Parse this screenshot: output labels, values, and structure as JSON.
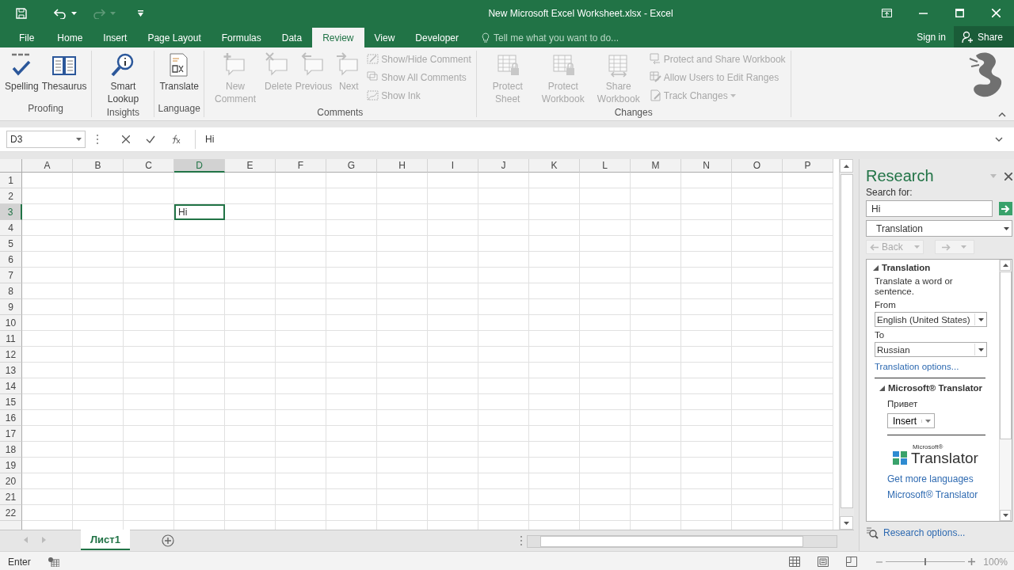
{
  "title_bar": {
    "title": "New Microsoft Excel Worksheet.xlsx - Excel"
  },
  "ribbon_tabs": [
    {
      "label": "File",
      "selected": false
    },
    {
      "label": "Home",
      "selected": false
    },
    {
      "label": "Insert",
      "selected": false
    },
    {
      "label": "Page Layout",
      "selected": false
    },
    {
      "label": "Formulas",
      "selected": false
    },
    {
      "label": "Data",
      "selected": false
    },
    {
      "label": "Review",
      "selected": true
    },
    {
      "label": "View",
      "selected": false
    },
    {
      "label": "Developer",
      "selected": false
    }
  ],
  "tell_me": {
    "placeholder": "Tell me what you want to do..."
  },
  "account": {
    "sign_in": "Sign in",
    "share": "Share"
  },
  "ribbon_groups": [
    {
      "label": "Proofing",
      "commands": [
        {
          "kind": "large",
          "label": "Spelling",
          "disabled": false
        },
        {
          "kind": "large",
          "label": "Thesaurus",
          "disabled": false
        }
      ]
    },
    {
      "label": "Insights",
      "commands": [
        {
          "kind": "large",
          "label": "Smart Lookup",
          "disabled": false
        }
      ]
    },
    {
      "label": "Language",
      "commands": [
        {
          "kind": "large",
          "label": "Translate",
          "disabled": false
        }
      ]
    },
    {
      "label": "Comments",
      "commands": [
        {
          "kind": "large",
          "label": "New Comment",
          "disabled": true
        },
        {
          "kind": "large",
          "label": "Delete",
          "disabled": true
        },
        {
          "kind": "large",
          "label": "Previous",
          "disabled": true
        },
        {
          "kind": "large",
          "label": "Next",
          "disabled": true
        },
        {
          "kind": "small",
          "label": "Show/Hide Comment",
          "disabled": true
        },
        {
          "kind": "small",
          "label": "Show All Comments",
          "disabled": true
        },
        {
          "kind": "small",
          "label": "Show Ink",
          "disabled": true
        }
      ]
    },
    {
      "label": "Changes",
      "commands": [
        {
          "kind": "large",
          "label": "Protect Sheet",
          "disabled": true
        },
        {
          "kind": "large",
          "label": "Protect Workbook",
          "disabled": true
        },
        {
          "kind": "large",
          "label": "Share Workbook",
          "disabled": true
        },
        {
          "kind": "small",
          "label": "Protect and Share Workbook",
          "disabled": true
        },
        {
          "kind": "small",
          "label": "Allow Users to Edit Ranges",
          "disabled": true
        },
        {
          "kind": "small",
          "label": "Track Changes",
          "disabled": true,
          "dropdown": true
        }
      ]
    }
  ],
  "formula_bar": {
    "name_box": "D3",
    "value": "Hi"
  },
  "sheet": {
    "columns": [
      "A",
      "B",
      "C",
      "D",
      "E",
      "F",
      "G",
      "H",
      "I",
      "J",
      "K",
      "L",
      "M",
      "N",
      "O",
      "P"
    ],
    "rows": [
      {
        "header": "1"
      },
      {
        "header": "2"
      },
      {
        "header": "3",
        "cells": [
          null,
          null,
          null,
          {
            "value": "Hi",
            "selected": true
          }
        ]
      },
      {
        "header": "4"
      },
      {
        "header": "5"
      },
      {
        "header": "6"
      },
      {
        "header": "7"
      },
      {
        "header": "8"
      },
      {
        "header": "9"
      },
      {
        "header": "10"
      },
      {
        "header": "11"
      },
      {
        "header": "12"
      },
      {
        "header": "13"
      },
      {
        "header": "14"
      },
      {
        "header": "15"
      },
      {
        "header": "16"
      },
      {
        "header": "17"
      },
      {
        "header": "18"
      },
      {
        "header": "19"
      },
      {
        "header": "20"
      },
      {
        "header": "21"
      },
      {
        "header": "22"
      }
    ]
  },
  "sheet_tabs": [
    {
      "label": "Лист1",
      "selected": true
    }
  ],
  "research": {
    "title": "Research",
    "search_label": "Search for:",
    "search_value": "Hi",
    "service": "Translation",
    "back": "Back",
    "section": {
      "heading": "Translation",
      "description": "Translate a word or sentence.",
      "from_label": "From",
      "from_value": "English (United States)",
      "to_label": "To",
      "to_value": "Russian",
      "options_link": "Translation options..."
    },
    "translator": {
      "heading": "Microsoft® Translator",
      "result": "Привет",
      "insert": "Insert",
      "logo_small": "Microsoft®",
      "logo_large": "Translator",
      "links": [
        "Get more languages",
        "Microsoft® Translator"
      ]
    },
    "options_link": "Research options..."
  },
  "status_bar": {
    "mode": "Enter",
    "zoom_slider": {
      "level": 0.5
    },
    "zoom": "100%"
  }
}
